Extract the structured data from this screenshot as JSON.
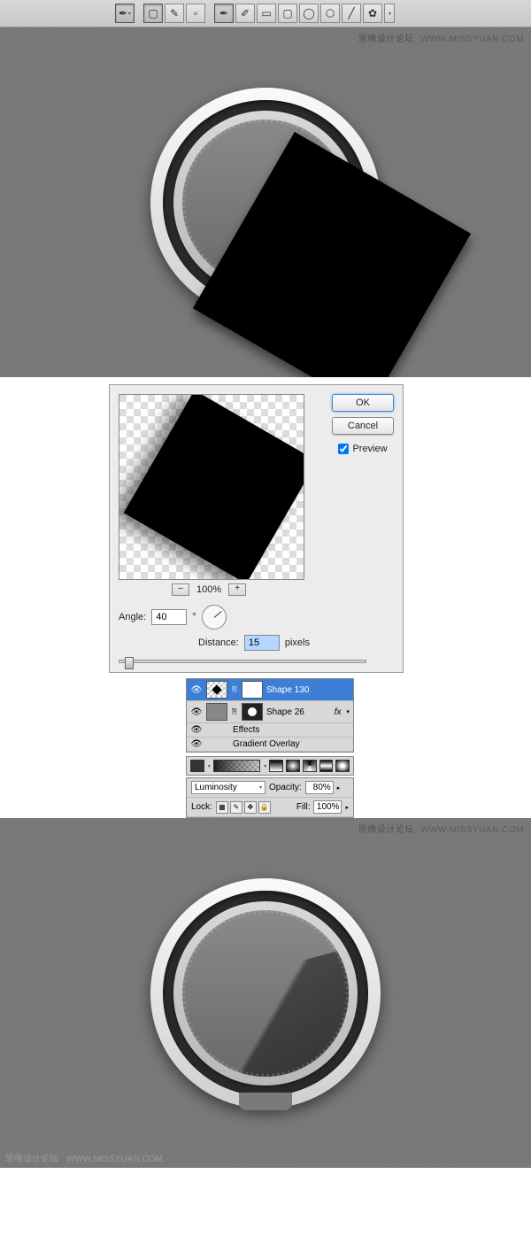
{
  "watermark": {
    "cn": "思缘设计论坛",
    "url": "WWW.MISSYUAN.COM"
  },
  "dialog": {
    "ok": "OK",
    "cancel": "Cancel",
    "preview_label": "Preview",
    "zoom": "100%",
    "angle_label": "Angle:",
    "angle_value": "40",
    "angle_unit": "°",
    "distance_label": "Distance:",
    "distance_value": "15",
    "distance_unit": "pixels"
  },
  "layers": {
    "shape130": "Shape 130",
    "shape26": "Shape 26",
    "fx": "fx",
    "effects": "Effects",
    "gradient_overlay": "Gradient Overlay"
  },
  "options": {
    "blend": "Luminosity",
    "opacity_label": "Opacity:",
    "opacity_value": "80%",
    "lock_label": "Lock:",
    "fill_label": "Fill:",
    "fill_value": "100%"
  },
  "chart_data": null
}
